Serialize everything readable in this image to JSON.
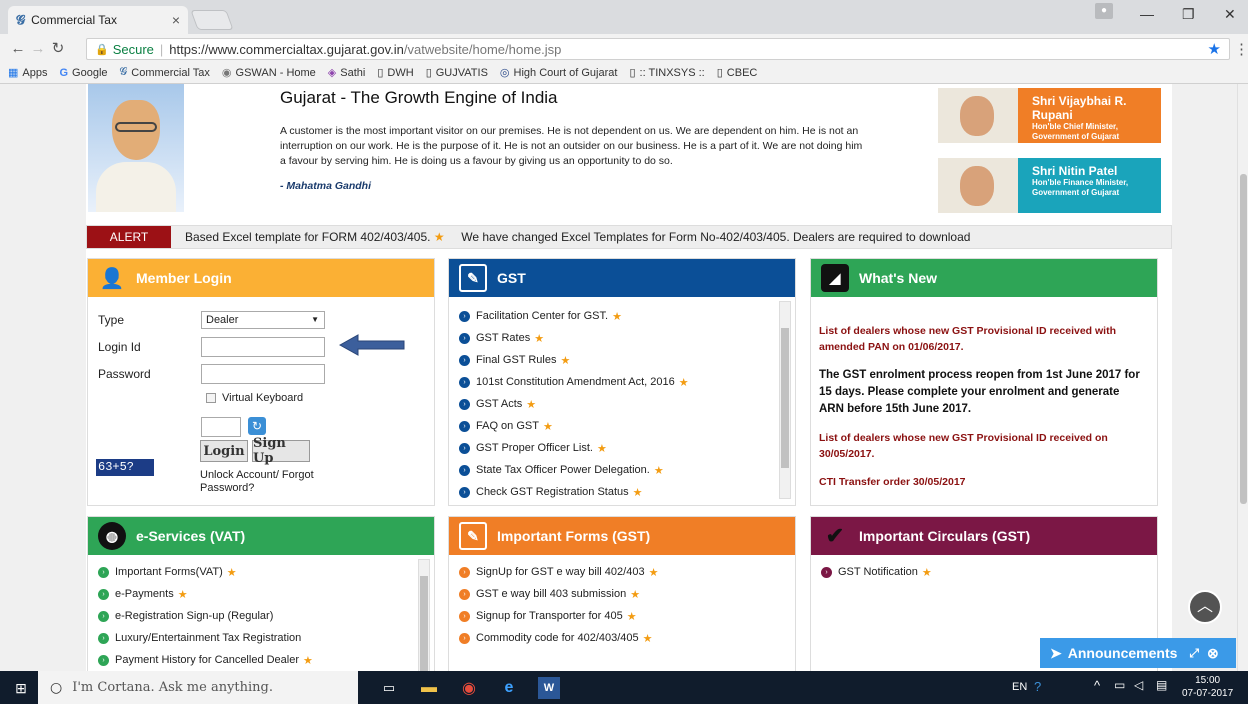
{
  "browser": {
    "tab_title": "Commercial Tax",
    "tab_favicon": "𝓖",
    "address_secure": "Secure",
    "address_url_host": "https://www.commercialtax.gujarat.gov.in",
    "address_url_path": "/vatwebsite/home/home.jsp",
    "bookmarks": [
      {
        "icon": "apps-icon",
        "label": "Apps"
      },
      {
        "icon": "google-icon",
        "label": "Google"
      },
      {
        "icon": "ct-icon",
        "label": "Commercial Tax"
      },
      {
        "icon": "gswan-icon",
        "label": "GSWAN - Home"
      },
      {
        "icon": "sathi-icon",
        "label": "Sathi"
      },
      {
        "icon": "page-icon",
        "label": "DWH"
      },
      {
        "icon": "page-icon",
        "label": "GUJVATIS"
      },
      {
        "icon": "court-icon",
        "label": "High Court of Gujarat"
      },
      {
        "icon": "page-icon",
        "label": ":: TINXSYS ::"
      },
      {
        "icon": "page-icon",
        "label": "CBEC"
      }
    ]
  },
  "banner": {
    "headline": "Gujarat - The Growth Engine of India",
    "quote": "A customer is the most important visitor on our premises. He is not dependent on us. We are dependent on him. He is not an interruption on our work. He is the purpose of it. He is not an outsider on our business. He is a part of it. We are not doing him a favour by serving him. He is doing us a favour by giving us an opportunity to do so.",
    "quote_author": "- Mahatma Gandhi",
    "ministers": [
      {
        "name": "Shri Vijaybhai R. Rupani",
        "role_1": "Hon'ble Chief Minister,",
        "role_2": "Government of Gujarat",
        "color": "#f07e26"
      },
      {
        "name": "Shri Nitin Patel",
        "role_1": "Hon'ble Finance Minister,",
        "role_2": "Government of Gujarat",
        "color": "#1aa4bb"
      }
    ]
  },
  "alert": {
    "label": "ALERT",
    "ticker_1": "Based Excel template for FORM 402/403/405.",
    "ticker_2": "We have changed Excel Templates for Form No-402/403/405. Dealers are required to download"
  },
  "login": {
    "title": "Member Login",
    "color": "#fbb034",
    "type_label": "Type",
    "type_value": "Dealer",
    "login_id_label": "Login Id",
    "password_label": "Password",
    "virtual_keyboard": "Virtual Keyboard",
    "captcha": "63+5?",
    "login_button": "Login",
    "signup_button": "Sign Up",
    "unlock_text": "Unlock Account/ Forgot Password?"
  },
  "gst": {
    "title": "GST",
    "color": "#0b4f97",
    "items": [
      "Facilitation Center for GST.",
      "GST Rates",
      "Final GST Rules",
      "101st Constitution Amendment Act, 2016",
      "GST Acts",
      "FAQ on GST",
      "GST Proper Officer List.",
      "State Tax Officer Power Delegation.",
      "Check GST Registration Status"
    ]
  },
  "whatsnew": {
    "title": "What's New",
    "color": "#2ea556",
    "items": [
      "List of dealers whose new GST Provisional ID received with amended PAN on 01/06/2017.",
      "The GST enrolment process reopen from 1st June 2017 for 15 days. Please complete your enrolment and generate ARN before 15th June 2017.",
      "List of dealers whose new GST Provisional ID received on 30/05/2017.",
      "CTI Transfer order 30/05/2017"
    ]
  },
  "eservices": {
    "title": "e-Services (VAT)",
    "color": "#2ea556",
    "items": [
      "Important Forms(VAT)",
      "e-Payments",
      "e-Registration Sign-up (Regular)",
      "Luxury/Entertainment Tax Registration",
      "Payment History for Cancelled Dealer"
    ]
  },
  "impforms": {
    "title": "Important Forms (GST)",
    "color": "#f07e26",
    "items": [
      "SignUp for GST e way bill 402/403",
      "GST e way bill 403 submission",
      "Signup for Transporter for 405",
      "Commodity code for 402/403/405"
    ]
  },
  "circulars": {
    "title": "Important Circulars (GST)",
    "color": "#7b1745",
    "items": [
      "GST Notification"
    ]
  },
  "announcements": {
    "label": "Announcements"
  },
  "taskbar": {
    "cortana": "I'm Cortana. Ask me anything.",
    "lang": "EN",
    "time": "15:00",
    "date": "07-07-2017"
  }
}
